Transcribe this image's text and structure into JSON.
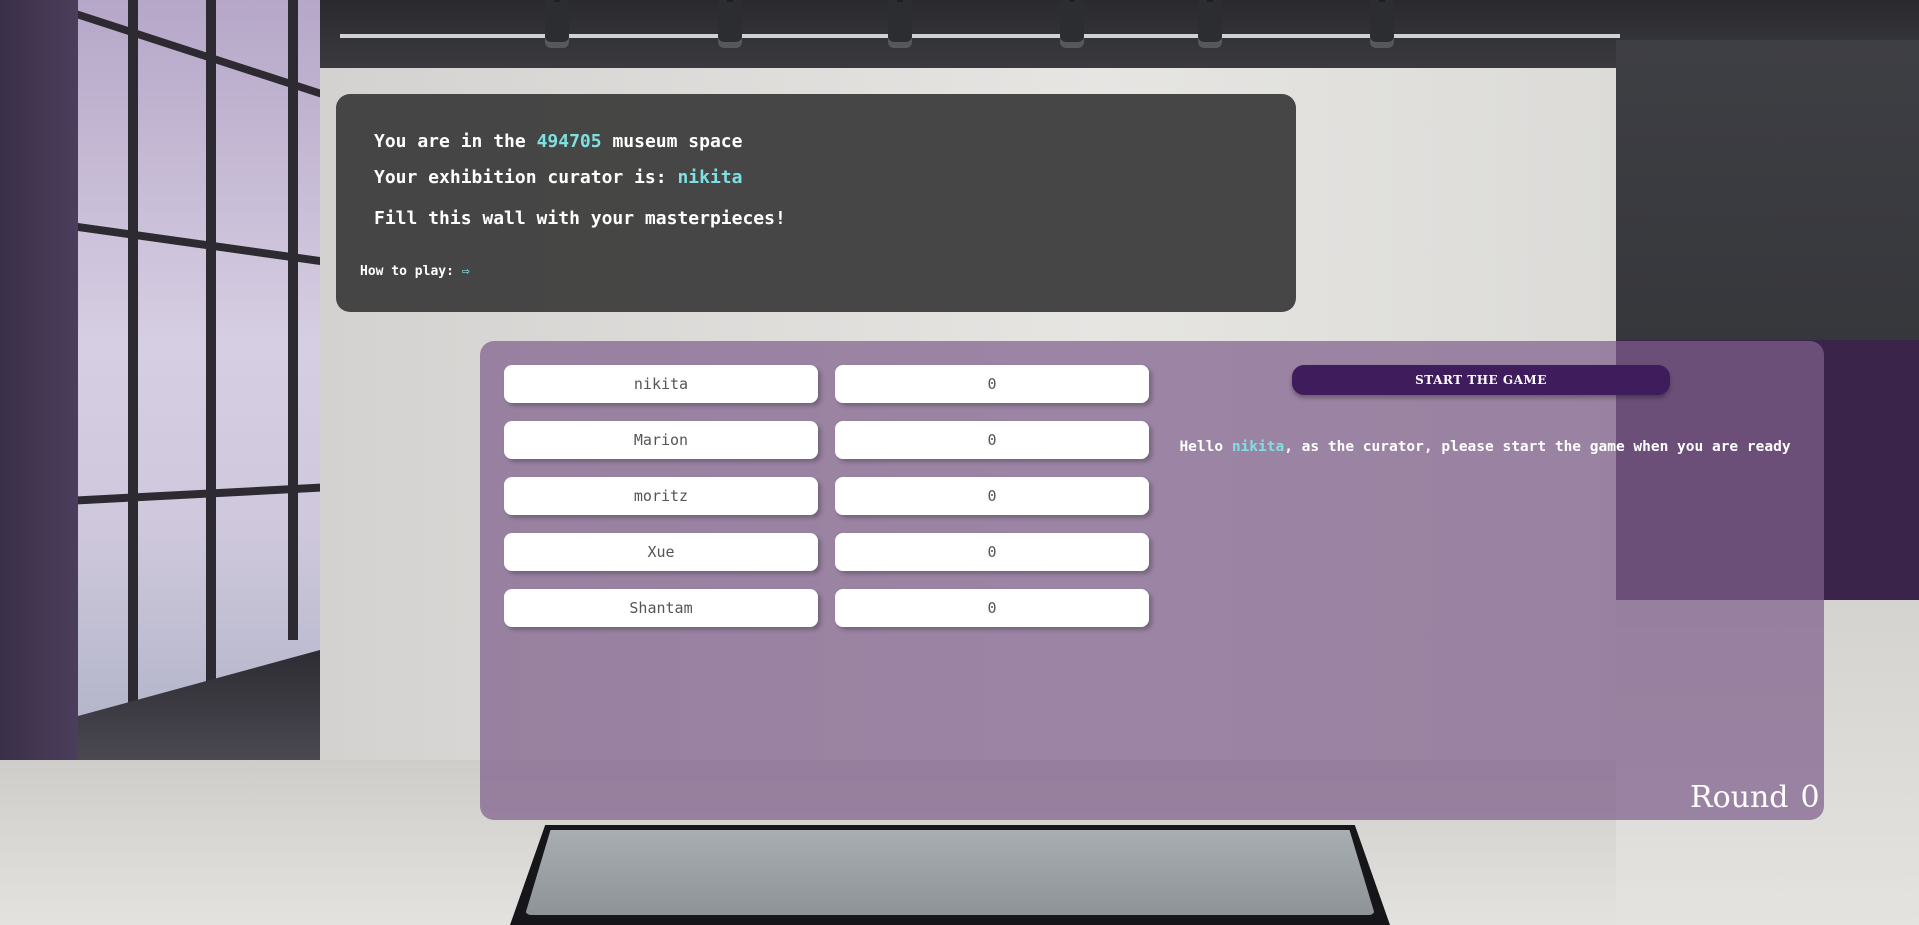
{
  "info": {
    "room_prefix": "You are in the",
    "room_code": "494705",
    "room_suffix": "museum space",
    "curator_prefix": "Your exhibition curator is:",
    "curator_name": "nikita",
    "instruction": "Fill this wall with your masterpieces!",
    "how_to_play_label": "How to play:",
    "how_to_play_icon": "right-arrow-icon",
    "how_to_play_glyph": "⇨"
  },
  "players": [
    {
      "name": "nikita",
      "score": "0"
    },
    {
      "name": "Marion",
      "score": "0"
    },
    {
      "name": "moritz",
      "score": "0"
    },
    {
      "name": "Xue",
      "score": "0"
    },
    {
      "name": "Shantam",
      "score": "0"
    }
  ],
  "controls": {
    "start_button_label": "START THE GAME"
  },
  "message": {
    "greeting": "Hello",
    "user": "nikita",
    "rest": ", as the curator, please start the game when you are ready"
  },
  "round": {
    "label": "Round",
    "number": "0"
  },
  "colors": {
    "accent": "#7ee0e0",
    "button": "#3f1d5c",
    "panel_dark": "#3a3a3a",
    "panel_purple": "#80608c"
  }
}
